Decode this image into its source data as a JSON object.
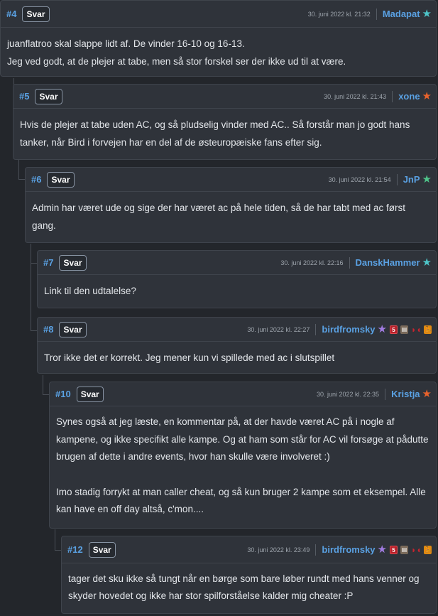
{
  "reply_label": "Svar",
  "colors": {
    "username": "#5aa1e3",
    "star_teal": "#4ec4c8",
    "star_orange": "#e8622c",
    "star_green": "#4fc48a",
    "star_purple": "#a07be0",
    "background": "#23262b",
    "card": "#2f333a"
  },
  "comments": [
    {
      "num": "#4",
      "date": "30. juni 2022 kl. 21:32",
      "user": "Madapat",
      "star": "teal-star",
      "badges": [],
      "paragraphs": [
        "juanflatroo skal slappe lidt af. De vinder 16-10 og 16-13.",
        "Jeg ved godt, at de plejer at tabe, men så stor forskel ser der ikke ud til at være."
      ]
    },
    {
      "num": "#5",
      "date": "30. juni 2022 kl. 21:43",
      "user": "xone",
      "star": "orange-star",
      "badges": [],
      "paragraphs": [
        "Hvis de plejer at tabe uden AC, og så pludselig vinder med AC.. Så forstår man jo godt hans tanker, når Bird i forvejen har en del af de østeuropæiske fans efter sig."
      ]
    },
    {
      "num": "#6",
      "date": "30. juni 2022 kl. 21:54",
      "user": "JnP",
      "star": "green-star",
      "badges": [],
      "paragraphs": [
        "Admin har været ude og sige der har været ac på hele tiden, så de har tabt med ac først gang."
      ]
    },
    {
      "num": "#7",
      "date": "30. juni 2022 kl. 22:16",
      "user": "DanskHammer",
      "star": "teal-star",
      "badges": [],
      "paragraphs": [
        "Link til den udtalelse?"
      ]
    },
    {
      "num": "#8",
      "date": "30. juni 2022 kl. 22:27",
      "user": "birdfromsky",
      "star": "purple-star",
      "badges": [
        "shield-5-badge",
        "box-badge",
        "redbull-badge",
        "runner-badge"
      ],
      "paragraphs": [
        "Tror ikke det er korrekt. Jeg mener kun vi spillede med ac i slutspillet"
      ]
    },
    {
      "num": "#10",
      "date": "30. juni 2022 kl. 22:35",
      "user": "Kristja",
      "star": "orange-star",
      "badges": [],
      "paragraphs": [
        "Synes også at jeg læste, en kommentar på, at der havde været AC på i nogle af kampene, og ikke specifikt alle kampe. Og at ham som står for AC vil forsøge at pådutte brugen af dette i andre events, hvor han skulle være involveret :)",
        "Imo stadig forrykt at man caller cheat, og så kun bruger 2 kampe som et eksempel. Alle kan have en off day altså, c'mon...."
      ]
    },
    {
      "num": "#12",
      "date": "30. juni 2022 kl. 23:49",
      "user": "birdfromsky",
      "star": "purple-star",
      "badges": [
        "shield-5-badge",
        "box-badge",
        "redbull-badge",
        "runner-badge"
      ],
      "paragraphs": [
        "tager det sku ikke så tungt når en børge som bare løber rundt med hans venner og skyder hovedet og ikke har stor spilforståelse kalder mig cheater :P"
      ]
    }
  ]
}
